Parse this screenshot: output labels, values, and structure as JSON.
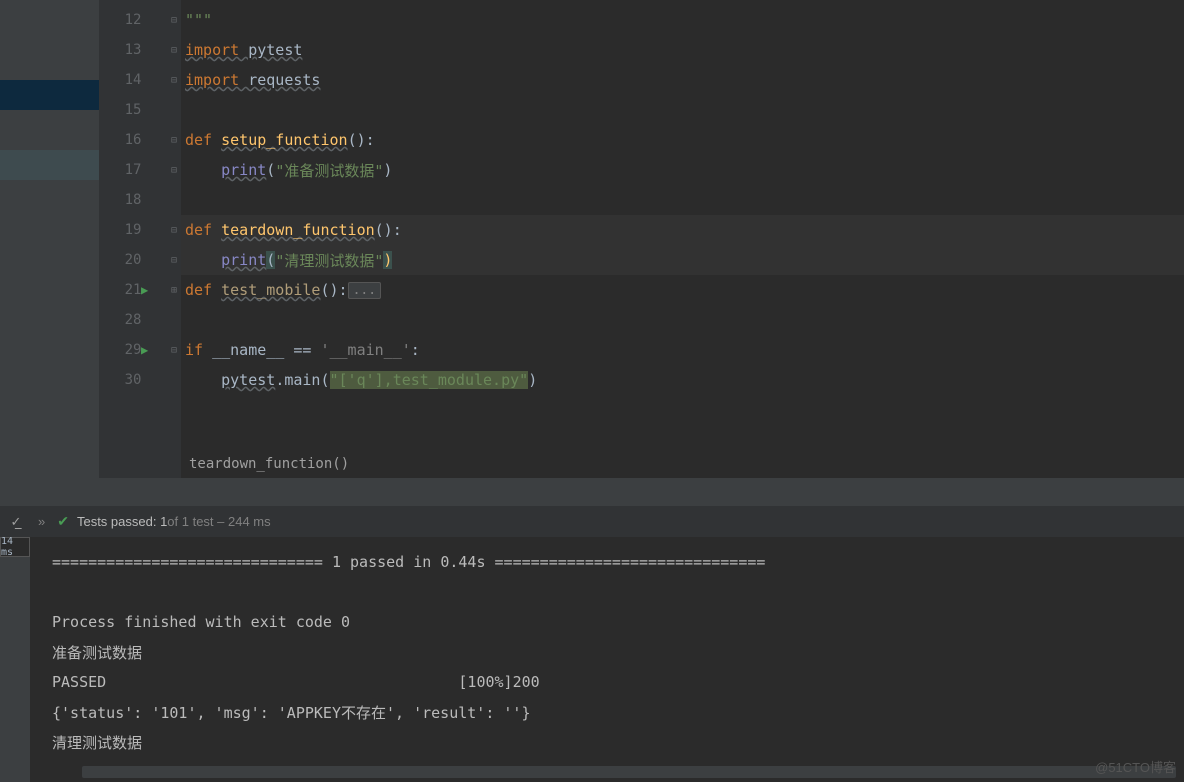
{
  "gutter": {
    "lines": [
      "12",
      "13",
      "14",
      "15",
      "16",
      "17",
      "18",
      "19",
      "20",
      "21",
      "28",
      "29",
      "30"
    ]
  },
  "code": {
    "l12": "\"\"\"",
    "l13_kw": "import",
    "l13_mod": " pytest",
    "l14_kw": "import",
    "l14_mod": " requests",
    "l16_def": "def ",
    "l16_fn": "setup_function",
    "l16_rest": "():",
    "l17_indent": "    ",
    "l17_print": "print",
    "l17_open": "(",
    "l17_str": "\"准备测试数据\"",
    "l17_close": ")",
    "l19_def": "def ",
    "l19_fn": "teardown_function",
    "l19_rest": "():",
    "l20_indent": "    ",
    "l20_print": "print",
    "l20_open": "(",
    "l20_str": "\"清理测试数据\"",
    "l20_close": ")",
    "l21_def": "def ",
    "l21_fn": "test_mobile",
    "l21_rest": "():",
    "l21_collapsed": "...",
    "l29_if": "if ",
    "l29_name": "__name__",
    "l29_eq": " == ",
    "l29_main": "'__main__'",
    "l29_colon": ":",
    "l30_indent": "    ",
    "l30_pytest": "pytest",
    "l30_dot": ".main(",
    "l30_str": "\"['q'],test_module.py\"",
    "l30_close": ")"
  },
  "breadcrumb": "teardown_function()",
  "tests": {
    "passed_label": "Tests passed: 1",
    "rest": " of 1 test – 244 ms"
  },
  "left_badge": "14 ms",
  "console": {
    "l1": "============================== 1 passed in 0.44s ==============================",
    "l2": "",
    "l3": "Process finished with exit code 0",
    "l4": "准备测试数据",
    "l5": "PASSED                                       [100%]200",
    "l6": "{'status': '101', 'msg': 'APPKEY不存在', 'result': ''}",
    "l7": "清理测试数据"
  },
  "watermark": "@51CTO博客"
}
